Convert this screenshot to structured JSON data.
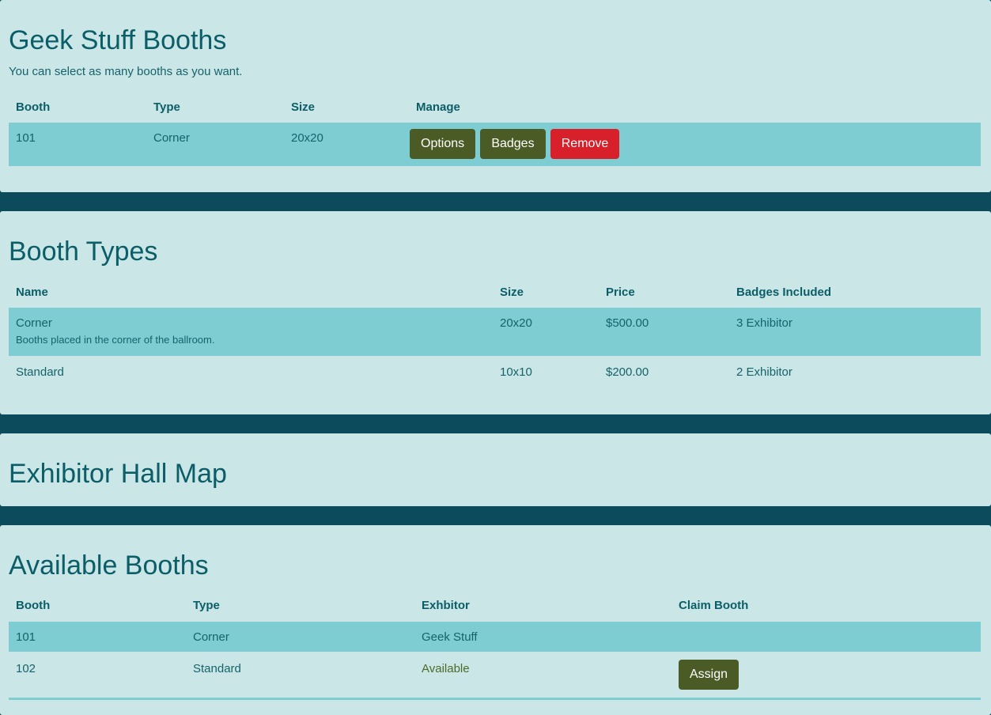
{
  "booths_panel": {
    "title": "Geek Stuff Booths",
    "subtitle": "You can select as many booths as you want.",
    "headers": {
      "booth": "Booth",
      "type": "Type",
      "size": "Size",
      "manage": "Manage"
    },
    "rows": [
      {
        "booth": "101",
        "type": "Corner",
        "size": "20x20"
      }
    ],
    "buttons": {
      "options": "Options",
      "badges": "Badges",
      "remove": "Remove"
    }
  },
  "booth_types_panel": {
    "title": "Booth Types",
    "headers": {
      "name": "Name",
      "size": "Size",
      "price": "Price",
      "badges": "Badges Included"
    },
    "rows": [
      {
        "name": "Corner",
        "description": "Booths placed in the corner of the ballroom.",
        "size": "20x20",
        "price": "$500.00",
        "badges": "3 Exhibitor"
      },
      {
        "name": "Standard",
        "description": "",
        "size": "10x10",
        "price": "$200.00",
        "badges": "2 Exhibitor"
      }
    ]
  },
  "map_panel": {
    "title": "Exhibitor Hall Map"
  },
  "available_panel": {
    "title": "Available Booths",
    "headers": {
      "booth": "Booth",
      "type": "Type",
      "exhibitor": "Exhbitor",
      "claim": "Claim Booth"
    },
    "rows": [
      {
        "booth": "101",
        "type": "Corner",
        "exhibitor": "Geek Stuff"
      },
      {
        "booth": "102",
        "type": "Standard",
        "exhibitor": "Available",
        "claim_label": "Assign"
      }
    ]
  },
  "colors": {
    "background": "#0b4b5c",
    "panel": "#cbe6e6",
    "row_highlight": "#7ecdd3",
    "text": "#15636b",
    "button_olive": "#4a5b25",
    "button_red": "#d7202a"
  }
}
